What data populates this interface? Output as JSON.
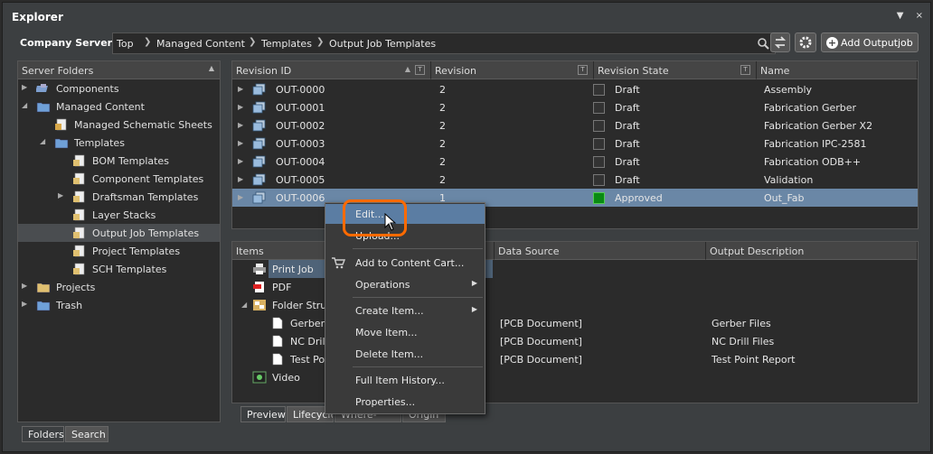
{
  "window": {
    "title": "Explorer",
    "title_buttons": [
      "▼",
      "×"
    ]
  },
  "toolbar": {
    "server_label": "Company Server",
    "breadcrumb": [
      "Top",
      "Managed Content",
      "Templates",
      "Output Job Templates"
    ],
    "add_button_label": "Add Outputjob"
  },
  "left_panel": {
    "header": "Server Folders",
    "tree": [
      {
        "label": "Components",
        "icon": "components-icon"
      },
      {
        "label": "Managed Content",
        "icon": "folder-icon"
      },
      {
        "label": "Managed Schematic Sheets",
        "icon": "schematic-sheets-icon"
      },
      {
        "label": "Templates",
        "icon": "folder-icon"
      },
      {
        "label": "BOM Templates",
        "icon": "bom-template-icon"
      },
      {
        "label": "Component Templates",
        "icon": "component-template-icon"
      },
      {
        "label": "Draftsman Templates",
        "icon": "draftsman-template-icon"
      },
      {
        "label": "Layer Stacks",
        "icon": "layer-stack-icon"
      },
      {
        "label": "Output Job Templates",
        "icon": "outjob-template-icon"
      },
      {
        "label": "Project Templates",
        "icon": "project-template-icon"
      },
      {
        "label": "SCH Templates",
        "icon": "sch-template-icon"
      },
      {
        "label": "Projects",
        "icon": "projects-icon"
      },
      {
        "label": "Trash",
        "icon": "trash-folder-icon"
      }
    ],
    "tabs": [
      "Folders",
      "Search"
    ]
  },
  "grid": {
    "columns": [
      "Revision ID",
      "Revision",
      "Revision State",
      "Name"
    ],
    "filter_glyph": "T",
    "rows": [
      {
        "id": "OUT-0000",
        "revision": "2",
        "state": "Draft",
        "name": "Assembly"
      },
      {
        "id": "OUT-0001",
        "revision": "2",
        "state": "Draft",
        "name": "Fabrication Gerber"
      },
      {
        "id": "OUT-0002",
        "revision": "2",
        "state": "Draft",
        "name": "Fabrication Gerber X2"
      },
      {
        "id": "OUT-0003",
        "revision": "2",
        "state": "Draft",
        "name": "Fabrication IPC-2581"
      },
      {
        "id": "OUT-0004",
        "revision": "2",
        "state": "Draft",
        "name": "Fabrication ODB++"
      },
      {
        "id": "OUT-0005",
        "revision": "2",
        "state": "Draft",
        "name": "Validation"
      },
      {
        "id": "OUT-0006",
        "revision": "1",
        "state": "Approved",
        "name": "Out_Fab"
      }
    ],
    "state_colors": {
      "Draft": "#333333",
      "Approved": "#0a8a14"
    }
  },
  "items": {
    "columns": [
      "Items",
      "Data Source",
      "Output Description"
    ],
    "rows": [
      {
        "label": "Print Job",
        "source": "",
        "desc": ""
      },
      {
        "label": "PDF",
        "source": "",
        "desc": ""
      },
      {
        "label": "Folder Stru",
        "source": "",
        "desc": ""
      },
      {
        "label": "Gerber",
        "source": "[PCB Document]",
        "desc": "Gerber Files"
      },
      {
        "label": "NC Drill",
        "source": "[PCB Document]",
        "desc": "NC Drill Files"
      },
      {
        "label": "Test Po",
        "source": "[PCB Document]",
        "desc": "Test Point Report"
      },
      {
        "label": "Video",
        "source": "",
        "desc": ""
      }
    ],
    "tabs": [
      "Preview",
      "Lifecycle",
      "Where-used",
      "Origin"
    ]
  },
  "context_menu": {
    "items": [
      {
        "label": "Edit...",
        "submenu": false
      },
      {
        "label": "Upload...",
        "submenu": false
      },
      {
        "label": "Add to Content Cart...",
        "submenu": false
      },
      {
        "label": "Operations",
        "submenu": true
      },
      {
        "label": "Create Item...",
        "submenu": true
      },
      {
        "label": "Move Item...",
        "submenu": false
      },
      {
        "label": "Delete Item...",
        "submenu": false
      },
      {
        "label": "Full Item History...",
        "submenu": false
      },
      {
        "label": "Properties...",
        "submenu": false
      }
    ],
    "highlight_color": "#5b7da3",
    "callout_color": "#ff6a00"
  }
}
